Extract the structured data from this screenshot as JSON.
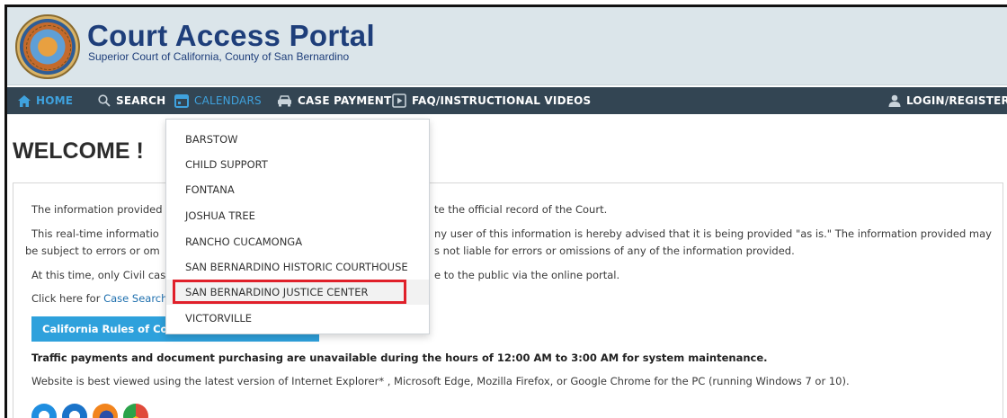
{
  "header": {
    "title": "Court Access Portal",
    "subtitle": "Superior Court of California, County of San Bernardino"
  },
  "nav": {
    "home": "HOME",
    "search": "SEARCH",
    "calendars": "CALENDARS",
    "case_payment": "CASE PAYMENT",
    "faq": "FAQ/INSTRUCTIONAL VIDEOS",
    "login": "LOGIN/REGISTER"
  },
  "welcome": "WELCOME !",
  "content": {
    "line1_a": "The information provided",
    "line1_b": "te the official record of the Court.",
    "line2_a": "This real-time informatio",
    "line2_b": "ny user of this information is hereby advised that it is being provided \"as is.\" The information provided may",
    "line3_a": "be subject to errors or om",
    "line3_b": "s not liable for errors or omissions of any of the information provided.",
    "line4_a": "At this time, only Civil cas",
    "line4_b": "e to the public via the online portal.",
    "line5_a": "Click here for ",
    "line5_link": "Case Search",
    "rules_button": "California Rules of Cou",
    "maintenance": "Traffic payments and document purchasing are unavailable during the hours of 12:00 AM to 3:00 AM for system maintenance.",
    "browsers": "Website is best viewed using the latest version of Internet Explorer* , Microsoft Edge, Mozilla Firefox, or Google Chrome for the PC (running Windows 7 or 10)."
  },
  "calendars_menu": {
    "items": [
      "BARSTOW",
      "CHILD SUPPORT",
      "FONTANA",
      "JOSHUA TREE",
      "RANCHO CUCAMONGA",
      "SAN BERNARDINO HISTORIC COURTHOUSE",
      "SAN BERNARDINO JUSTICE CENTER",
      "VICTORVILLE"
    ],
    "selected_index": 6
  },
  "colors": {
    "nav_bg": "#334553",
    "accent": "#3fa2de",
    "title": "#1e3e7a",
    "button": "#2ea1dc",
    "highlight": "#e0202a"
  }
}
